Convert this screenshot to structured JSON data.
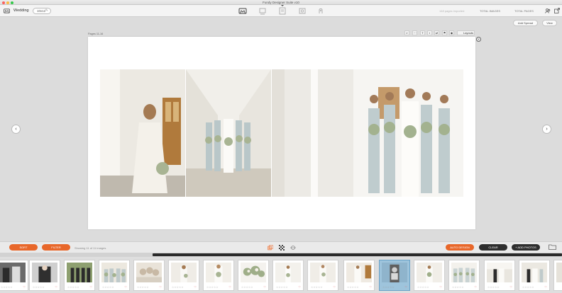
{
  "window": {
    "title": "Fundy Designer Suite v10"
  },
  "header": {
    "project_name": "Wedding",
    "album_size": "10x12",
    "stats": {
      "used_images": "148 pages imported",
      "total_images": "TOTAL IMAGES",
      "total_pages": "TOTAL PAGES"
    },
    "mode_icons": [
      "album-designer-icon",
      "wall-art-icon",
      "blog-collage-icon",
      "image-brander-icon",
      "proof-icon"
    ]
  },
  "workspace": {
    "add_spread_label": "Add Spread",
    "view_label": "View",
    "pages_label": "Pages 11-16",
    "layouts_label": "Layouts",
    "close_glyph": "×",
    "prev_glyph": "‹",
    "next_glyph": "›"
  },
  "toolbar": {
    "sort_label": "SORT",
    "filter_label": "FILTER",
    "showing_text": "Showing 11 of 11 images",
    "autodesign_label": "AUTO DESIGN",
    "clear_label": "CLEAR",
    "add_photos_label": "+ ADD PHOTOS"
  },
  "filmstrip": {
    "stars_text": "☆☆☆☆☆",
    "heart_glyph": "♡",
    "count": 17
  },
  "colors": {
    "accent_orange": "#e8672a",
    "badge_blue": "#46a2c9",
    "dark_pill": "#2e2e2e"
  }
}
